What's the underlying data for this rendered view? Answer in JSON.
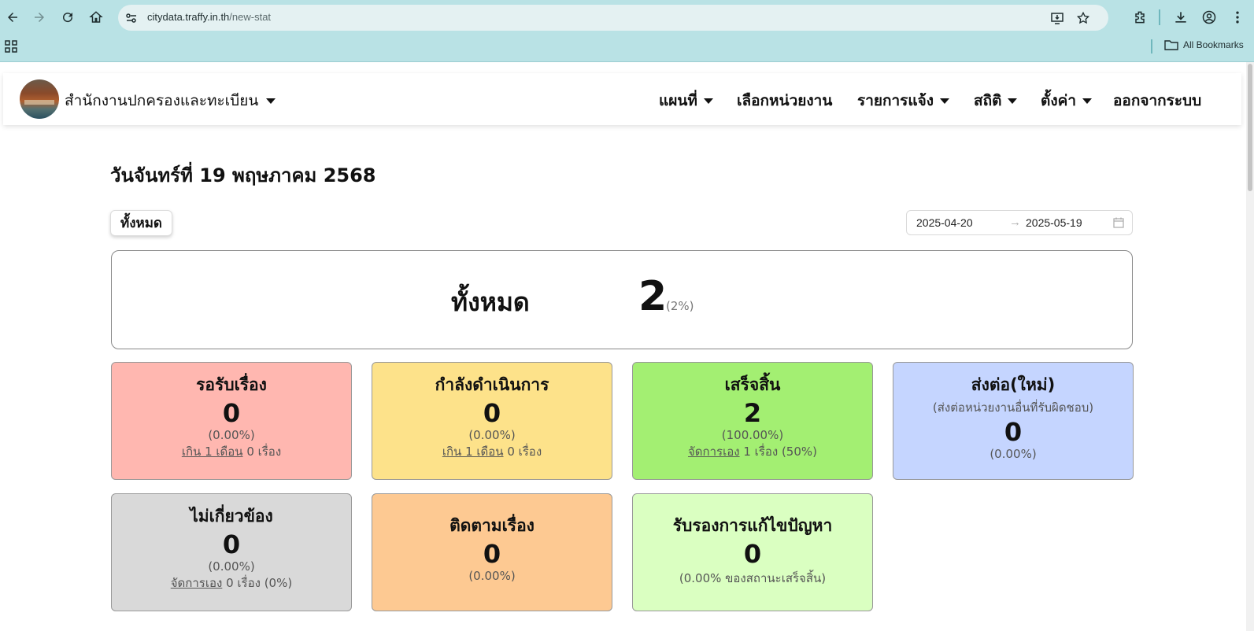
{
  "browser": {
    "url_domain": "citydata.traffy.in.th",
    "url_path": "/new-stat",
    "bookmarks_label": "All Bookmarks"
  },
  "navbar": {
    "brand": "สำนักงานปกครองและทะเบียน",
    "menu": {
      "map": "แผนที่",
      "select_unit": "เลือกหน่วยงาน",
      "reports": "รายการแจ้ง",
      "stats": "สถิติ",
      "settings": "ตั้งค่า",
      "logout": "ออกจากระบบ"
    }
  },
  "header": {
    "date_title": "วันจันทร์ที่ 19 พฤษภาคม 2568",
    "all_button": "ทั้งหมด",
    "date_from": "2025-04-20",
    "date_arrow": "→",
    "date_to": "2025-05-19"
  },
  "total": {
    "label": "ทั้งหมด",
    "value": "2",
    "pct": "(2%)"
  },
  "cards": {
    "waiting": {
      "title": "รอรับเรื่อง",
      "value": "0",
      "pct": "(0.00%)",
      "link": "เกิน 1 เดือน",
      "extra": "0 เรื่อง"
    },
    "in_progress": {
      "title": "กำลังดำเนินการ",
      "value": "0",
      "pct": "(0.00%)",
      "link": "เกิน 1 เดือน",
      "extra": "0 เรื่อง"
    },
    "done": {
      "title": "เสร็จสิ้น",
      "value": "2",
      "pct": "(100.00%)",
      "link": "จัดการเอง",
      "extra": "1 เรื่อง (50%)"
    },
    "forwarded": {
      "title": "ส่งต่อ(ใหม่)",
      "subtitle": "(ส่งต่อหน่วยงานอื่นที่รับผิดชอบ)",
      "value": "0",
      "pct": "(0.00%)"
    },
    "irrelevant": {
      "title": "ไม่เกี่ยวข้อง",
      "value": "0",
      "pct": "(0.00%)",
      "link": "จัดการเอง",
      "extra": "0 เรื่อง (0%)"
    },
    "follow": {
      "title": "ติดตามเรื่อง",
      "value": "0",
      "pct": "(0.00%)"
    },
    "certified": {
      "title": "รับรองการแก้ไขปัญหา",
      "value": "0",
      "pct": "(0.00% ของสถานะเสร็จสิ้น)"
    }
  },
  "colors": {
    "waiting": "#ffb7b0",
    "in_progress": "#fde28a",
    "done": "#a3ef72",
    "forwarded": "#c5d5ff",
    "irrelevant": "#d9d9d9",
    "follow": "#fdc992",
    "certified": "#daffc1",
    "chrome": "#b9e2e5"
  }
}
